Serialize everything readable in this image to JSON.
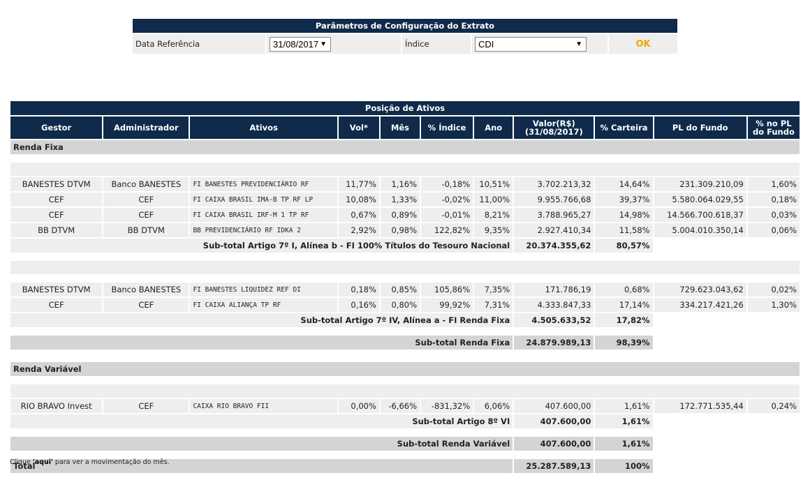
{
  "params": {
    "title": "Parâmetros de Configuração do Extrato",
    "date_label": "Data Referência",
    "date_value": "31/08/2017",
    "index_label": "Índice",
    "index_value": "CDI",
    "ok_label": "OK"
  },
  "positions": {
    "title": "Posição de Ativos",
    "columns": [
      "Gestor",
      "Administrador",
      "Ativos",
      "Vol*",
      "Mês",
      "% Índice",
      "Ano",
      "Valor(R$)",
      "% Carteira",
      "PL do Fundo",
      "% no PL"
    ],
    "valor_sub": "(31/08/2017)",
    "pl_sub": "do Fundo",
    "renda_fixa": {
      "label": "Renda Fixa",
      "group1": [
        [
          "BANESTES DTVM",
          "Banco BANESTES",
          "FI BANESTES PREVIDENCIÁRIO RF",
          "11,77%",
          "1,16%",
          "-0,18%",
          "10,51%",
          "3.702.213,32",
          "14,64%",
          "231.309.210,09",
          "1,60%"
        ],
        [
          "CEF",
          "CEF",
          "FI CAIXA BRASIL IMA-B TP RF LP",
          "10,08%",
          "1,33%",
          "-0,02%",
          "11,00%",
          "9.955.766,68",
          "39,37%",
          "5.580.064.029,55",
          "0,18%"
        ],
        [
          "CEF",
          "CEF",
          "FI CAIXA BRASIL IRF-M 1 TP RF",
          "0,67%",
          "0,89%",
          "-0,01%",
          "8,21%",
          "3.788.965,27",
          "14,98%",
          "14.566.700.618,37",
          "0,03%"
        ],
        [
          "BB DTVM",
          "BB DTVM",
          "BB PREVIDENCIÁRIO RF IDKA 2",
          "2,92%",
          "0,98%",
          "122,82%",
          "9,35%",
          "2.927.410,34",
          "11,58%",
          "5.004.010.350,14",
          "0,06%"
        ]
      ],
      "sub1": {
        "label": "Sub-total Artigo 7º I, Alínea b - FI 100% Títulos do Tesouro Nacional",
        "valor": "20.374.355,62",
        "pct": "80,57%"
      },
      "group2": [
        [
          "BANESTES DTVM",
          "Banco BANESTES",
          "FI BANESTES LIQUIDEZ REF DI",
          "0,18%",
          "0,85%",
          "105,86%",
          "7,35%",
          "171.786,19",
          "0,68%",
          "729.623.043,62",
          "0,02%"
        ],
        [
          "CEF",
          "CEF",
          "FI CAIXA ALIANÇA TP RF",
          "0,16%",
          "0,80%",
          "99,92%",
          "7,31%",
          "4.333.847,33",
          "17,14%",
          "334.217.421,26",
          "1,30%"
        ]
      ],
      "sub2": {
        "label": "Sub-total Artigo 7º IV, Alínea a - FI Renda Fixa",
        "valor": "4.505.633,52",
        "pct": "17,82%"
      },
      "subtotal": {
        "label": "Sub-total Renda Fixa",
        "valor": "24.879.989,13",
        "pct": "98,39%"
      }
    },
    "renda_variavel": {
      "label": "Renda Variável",
      "group1": [
        [
          "RIO BRAVO Invest",
          "CEF",
          "CAIXA RIO BRAVO FII",
          "0,00%",
          "-6,66%",
          "-831,32%",
          "6,06%",
          "407.600,00",
          "1,61%",
          "172.771.535,44",
          "0,24%"
        ]
      ],
      "sub1": {
        "label": "Sub-total Artigo 8º VI",
        "valor": "407.600,00",
        "pct": "1,61%"
      },
      "subtotal": {
        "label": "Sub-total Renda Variável",
        "valor": "407.600,00",
        "pct": "1,61%"
      }
    },
    "total": {
      "label": "Total",
      "valor": "25.287.589,13",
      "pct": "100%"
    }
  },
  "footer": {
    "prefix": "Clique ",
    "link": "'aqui'",
    "suffix": " para ver a movimentação do mês."
  }
}
